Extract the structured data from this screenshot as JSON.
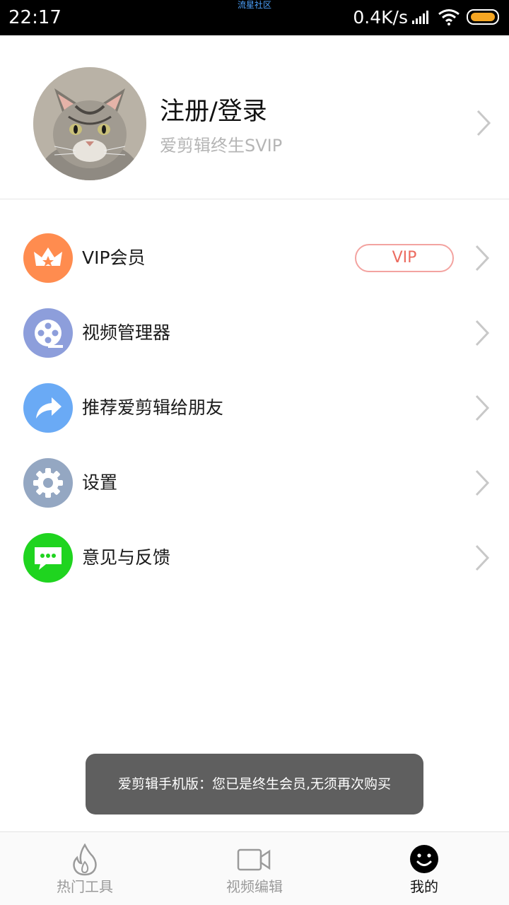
{
  "status_bar": {
    "time": "22:17",
    "center_text": "流星社区",
    "network_speed": "0.4K/s"
  },
  "profile": {
    "title": "注册/登录",
    "subtitle": "爱剪辑终生SVIP"
  },
  "menu": {
    "items": [
      {
        "label": "VIP会员",
        "icon": "crown-icon",
        "color": "#ff8c4f",
        "badge": "VIP"
      },
      {
        "label": "视频管理器",
        "icon": "film-reel-icon",
        "color": "#8d9edb"
      },
      {
        "label": "推荐爱剪辑给朋友",
        "icon": "share-arrow-icon",
        "color": "#6aaaf5"
      },
      {
        "label": "设置",
        "icon": "gear-icon",
        "color": "#94a7c2"
      },
      {
        "label": "意见与反馈",
        "icon": "chat-bubble-icon",
        "color": "#1fd41f"
      }
    ]
  },
  "toast": {
    "message": "爱剪辑手机版：您已是终生会员,无须再次购买"
  },
  "bottom_nav": {
    "items": [
      {
        "label": "热门工具",
        "icon": "flame-icon",
        "active": false
      },
      {
        "label": "视频编辑",
        "icon": "video-camera-icon",
        "active": false
      },
      {
        "label": "我的",
        "icon": "smiley-face-icon",
        "active": true
      }
    ]
  },
  "colors": {
    "vip_badge": "#ec6b5f",
    "battery": "#f5a623"
  }
}
